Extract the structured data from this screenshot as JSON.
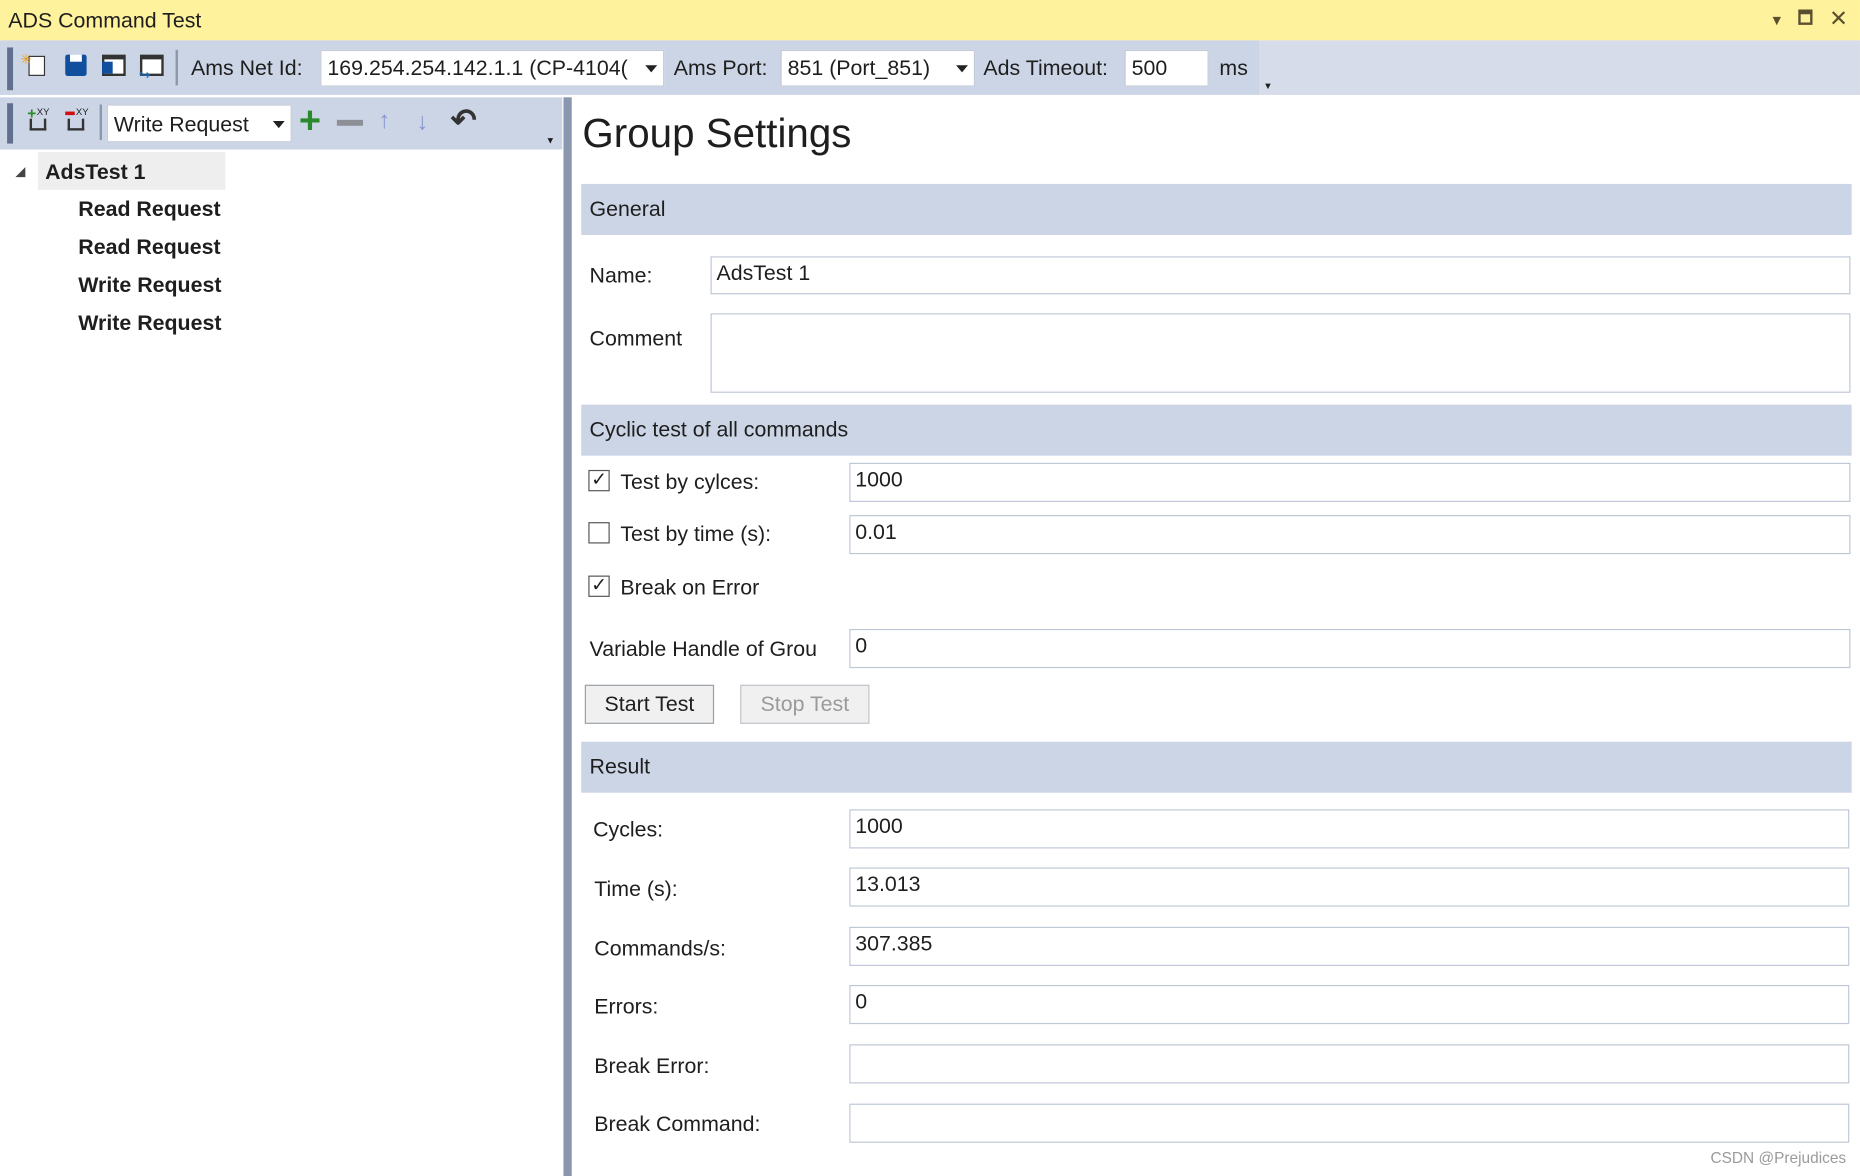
{
  "window": {
    "title": "ADS Command Test",
    "controls": [
      "dropdown-icon",
      "maximize-icon",
      "close-icon"
    ],
    "title_bg": "#fff29d"
  },
  "toolbar": {
    "icons": [
      "new-icon",
      "save-icon",
      "save-as-icon",
      "open-icon"
    ],
    "ams_net_id_label": "Ams Net Id:",
    "ams_net_id_value": "169.254.254.142.1.1 (CP-4104(",
    "ams_port_label": "Ams Port:",
    "ams_port_value": "851 (Port_851)",
    "ads_timeout_label": "Ads Timeout:",
    "ads_timeout_value": "500",
    "ads_timeout_unit": "ms"
  },
  "tree_toolbar": {
    "add_group_icon": "add-group-icon",
    "remove_group_icon": "remove-group-icon",
    "command_type": "Write Request",
    "add": "+",
    "remove": "−",
    "up": "↑",
    "down": "↓",
    "undo": "↶"
  },
  "tree": {
    "root": "AdsTest 1",
    "children": [
      "Read Request",
      "Read Request",
      "Write Request",
      "Write Request"
    ]
  },
  "main": {
    "heading": "Group Settings",
    "general": {
      "header": "General",
      "name_label": "Name:",
      "name_value": "AdsTest 1",
      "comment_label": "Comment",
      "comment_value": ""
    },
    "cyclic": {
      "header": "Cyclic test of all commands",
      "test_by_cycles_label": "Test by cylces:",
      "test_by_cycles_checked": true,
      "test_by_cycles_value": "1000",
      "test_by_time_label": "Test by time (s):",
      "test_by_time_checked": false,
      "test_by_time_value": "0.01",
      "break_on_error_label": "Break on Error",
      "break_on_error_checked": true,
      "var_handle_label": "Variable Handle of Grou",
      "var_handle_value": "0",
      "start_button": "Start Test",
      "stop_button": "Stop Test"
    },
    "result": {
      "header": "Result",
      "rows": [
        {
          "label": "Cycles:",
          "value": "1000"
        },
        {
          "label": "Time (s):",
          "value": "13.013"
        },
        {
          "label": "Commands/s:",
          "value": "307.385"
        },
        {
          "label": "Errors:",
          "value": "0"
        },
        {
          "label": "Break Error:",
          "value": ""
        },
        {
          "label": "Break Command:",
          "value": ""
        }
      ]
    }
  },
  "watermark": "CSDN @Prejudices"
}
